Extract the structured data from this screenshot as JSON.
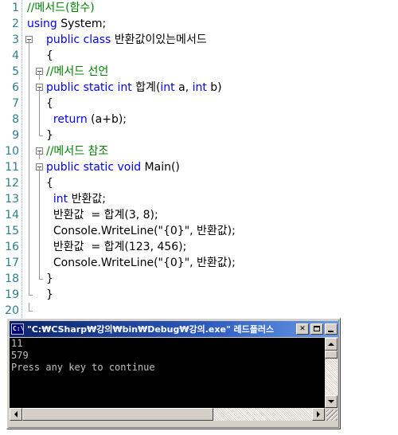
{
  "editor": {
    "name": "code-editor",
    "colors": {
      "keyword": "#0000FF",
      "comment": "#008000",
      "text": "#000000",
      "line_number": "#2B8189",
      "background": "#FFFFFF"
    },
    "lines": [
      {
        "num": "1",
        "fold": "none",
        "fold2": "none",
        "indent": 1,
        "tokens": [
          {
            "t": "//메서드(함수)",
            "c": "cm"
          }
        ]
      },
      {
        "num": "2",
        "fold": "none",
        "fold2": "none",
        "indent": 1,
        "tokens": [
          {
            "t": "using ",
            "c": "kw"
          },
          {
            "t": "System;",
            "c": "tx"
          }
        ]
      },
      {
        "num": "3",
        "fold": "box",
        "fold2": "none",
        "indent": 0,
        "tokens": [
          {
            "t": "public class ",
            "c": "kw"
          },
          {
            "t": "반환값이있는메서드",
            "c": "tx"
          }
        ]
      },
      {
        "num": "4",
        "fold": "line",
        "fold2": "none",
        "indent": 0,
        "tokens": [
          {
            "t": "{",
            "c": "tx"
          }
        ]
      },
      {
        "num": "5",
        "fold": "line",
        "fold2": "box",
        "indent": 0,
        "tokens": [
          {
            "t": "//메서드 선언",
            "c": "cm"
          }
        ]
      },
      {
        "num": "6",
        "fold": "line",
        "fold2": "box",
        "indent": 0,
        "tokens": [
          {
            "t": "public static int ",
            "c": "kw"
          },
          {
            "t": "합계",
            "c": "tx"
          },
          {
            "t": "(",
            "c": "tx"
          },
          {
            "t": "int ",
            "c": "kw"
          },
          {
            "t": "a, ",
            "c": "tx"
          },
          {
            "t": "int ",
            "c": "kw"
          },
          {
            "t": "b)",
            "c": "tx"
          }
        ]
      },
      {
        "num": "7",
        "fold": "line",
        "fold2": "line",
        "indent": 0,
        "tokens": [
          {
            "t": "{",
            "c": "tx"
          }
        ]
      },
      {
        "num": "8",
        "fold": "line",
        "fold2": "line",
        "indent": 0,
        "tokens": [
          {
            "t": "  return ",
            "c": "kw"
          },
          {
            "t": "(a+b);",
            "c": "tx"
          }
        ]
      },
      {
        "num": "9",
        "fold": "line",
        "fold2": "tick",
        "indent": 0,
        "tokens": [
          {
            "t": "}",
            "c": "tx"
          }
        ]
      },
      {
        "num": "10",
        "fold": "line",
        "fold2": "box",
        "indent": 0,
        "tokens": [
          {
            "t": "//메서드 참조",
            "c": "cm"
          }
        ]
      },
      {
        "num": "11",
        "fold": "line",
        "fold2": "box",
        "indent": 0,
        "tokens": [
          {
            "t": "public static void ",
            "c": "kw"
          },
          {
            "t": "Main()",
            "c": "tx"
          }
        ]
      },
      {
        "num": "12",
        "fold": "line",
        "fold2": "line",
        "indent": 0,
        "tokens": [
          {
            "t": "{",
            "c": "tx"
          }
        ]
      },
      {
        "num": "13",
        "fold": "line",
        "fold2": "line",
        "indent": 0,
        "tokens": [
          {
            "t": "  int ",
            "c": "kw"
          },
          {
            "t": "반환값;",
            "c": "tx"
          }
        ]
      },
      {
        "num": "14",
        "fold": "line",
        "fold2": "line",
        "indent": 0,
        "tokens": [
          {
            "t": "  반환값  = 합계(3, 8);",
            "c": "tx"
          }
        ]
      },
      {
        "num": "15",
        "fold": "line",
        "fold2": "line",
        "indent": 0,
        "tokens": [
          {
            "t": "  Console.WriteLine(\"{0}\", 반환값);",
            "c": "tx"
          }
        ]
      },
      {
        "num": "16",
        "fold": "line",
        "fold2": "line",
        "indent": 0,
        "tokens": [
          {
            "t": "  반환값  = 합계(123, 456);",
            "c": "tx"
          }
        ]
      },
      {
        "num": "17",
        "fold": "line",
        "fold2": "line",
        "indent": 0,
        "tokens": [
          {
            "t": "  Console.WriteLine(\"{0}\", 반환값);",
            "c": "tx"
          }
        ]
      },
      {
        "num": "18",
        "fold": "line",
        "fold2": "tick",
        "indent": 0,
        "tokens": [
          {
            "t": "}",
            "c": "tx"
          }
        ]
      },
      {
        "num": "19",
        "fold": "tick",
        "fold2": "none",
        "indent": 0,
        "tokens": [
          {
            "t": "}",
            "c": "tx"
          }
        ]
      },
      {
        "num": "20",
        "fold": "endtick",
        "fold2": "none",
        "indent": 0,
        "tokens": []
      }
    ]
  },
  "console_window": {
    "name": "console-window",
    "title": "\"C:₩CSharp₩강의₩bin₩Debug₩강의.exe\" 레드플러스",
    "icon": "console-window-icon",
    "icon_text": "C:\\",
    "buttons": {
      "minimize": "_",
      "maximize": "□",
      "close": "✕"
    },
    "output_lines": [
      "11",
      "579",
      "Press any key to continue"
    ],
    "output_colors": {
      "background": "#000000",
      "foreground": "#C0C0C0"
    }
  }
}
